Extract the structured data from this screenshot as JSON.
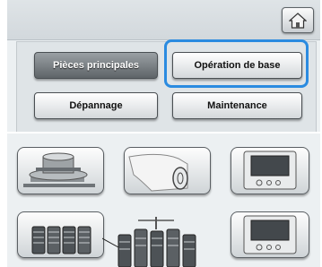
{
  "tabs": {
    "main_parts": "Pièces principales",
    "basic_operation": "Opération de base",
    "troubleshooting": "Dépannage",
    "maintenance": "Maintenance"
  },
  "icons": {
    "home": "home-icon",
    "bobbin": "bobbin-winder-icon",
    "embroidery_arm": "embroidery-arm-icon",
    "display_panel": "display-panel-icon",
    "thread_spools": "thread-spools-icon",
    "thread_stand": "thread-stand-icon",
    "display_panel_2": "display-panel-icon"
  },
  "colors": {
    "highlight": "#2b8be0"
  }
}
